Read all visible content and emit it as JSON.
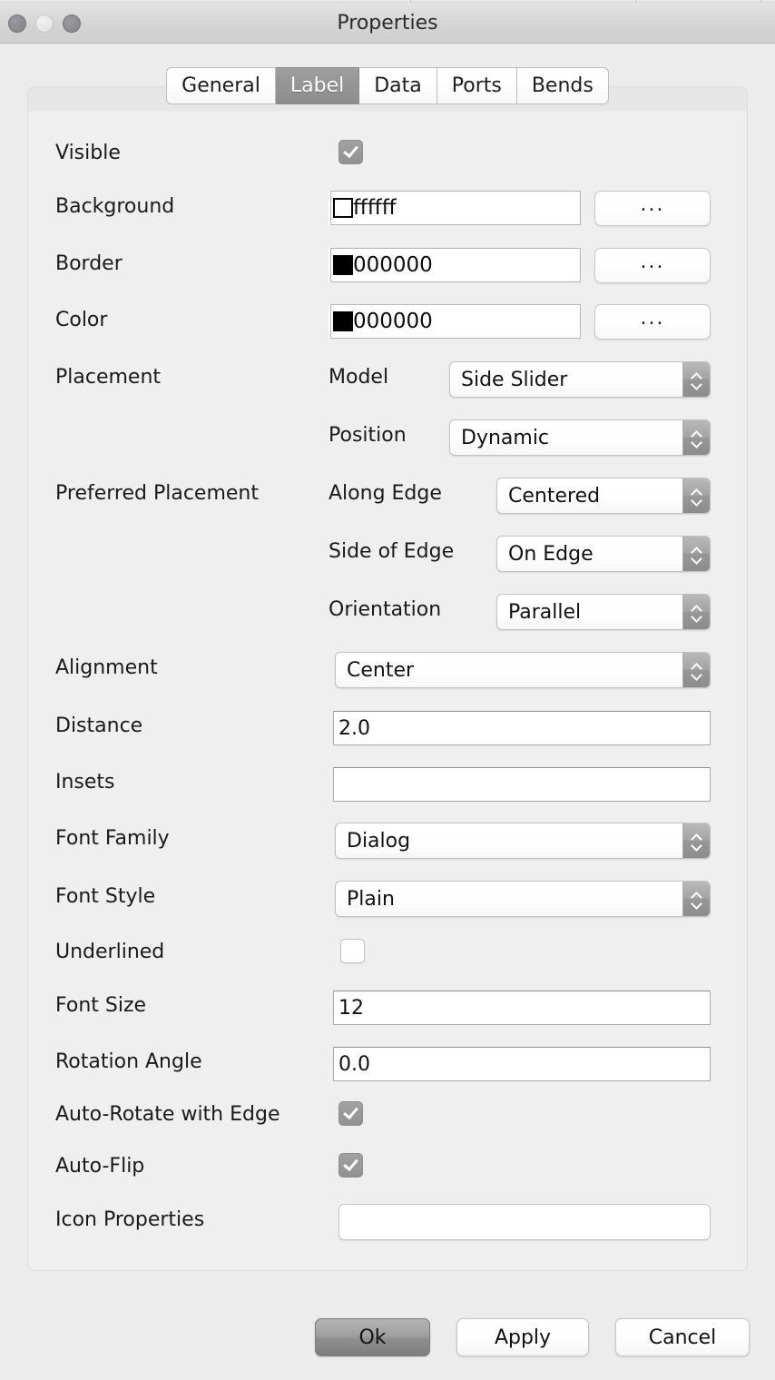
{
  "window": {
    "title": "Properties",
    "traffic_lights": [
      "close",
      "minimize",
      "zoom"
    ]
  },
  "tabs": [
    {
      "label": "General",
      "active": false
    },
    {
      "label": "Label",
      "active": true
    },
    {
      "label": "Data",
      "active": false
    },
    {
      "label": "Ports",
      "active": false
    },
    {
      "label": "Bends",
      "active": false
    }
  ],
  "form": {
    "visible": {
      "label": "Visible",
      "checked": true
    },
    "background": {
      "label": "Background",
      "value": "ffffff",
      "swatch": "#ffffff",
      "button": "..."
    },
    "border": {
      "label": "Border",
      "value": "000000",
      "swatch": "#000000",
      "button": "..."
    },
    "color": {
      "label": "Color",
      "value": "000000",
      "swatch": "#000000",
      "button": "..."
    },
    "placement": {
      "label": "Placement",
      "model": {
        "label": "Model",
        "value": "Side Slider"
      },
      "position": {
        "label": "Position",
        "value": "Dynamic"
      }
    },
    "preferred_placement": {
      "label": "Preferred Placement",
      "along_edge": {
        "label": "Along Edge",
        "value": "Centered"
      },
      "side_of_edge": {
        "label": "Side of Edge",
        "value": "On Edge"
      },
      "orientation": {
        "label": "Orientation",
        "value": "Parallel"
      }
    },
    "alignment": {
      "label": "Alignment",
      "value": "Center"
    },
    "distance": {
      "label": "Distance",
      "value": "2.0"
    },
    "insets": {
      "label": "Insets",
      "value": ""
    },
    "font_family": {
      "label": "Font Family",
      "value": "Dialog"
    },
    "font_style": {
      "label": "Font Style",
      "value": "Plain"
    },
    "underlined": {
      "label": "Underlined",
      "checked": false
    },
    "font_size": {
      "label": "Font Size",
      "value": "12"
    },
    "rotation_angle": {
      "label": "Rotation Angle",
      "value": "0.0"
    },
    "auto_rotate": {
      "label": "Auto-Rotate with Edge",
      "checked": true
    },
    "auto_flip": {
      "label": "Auto-Flip",
      "checked": true
    },
    "icon_properties": {
      "label": "Icon Properties",
      "value": ""
    }
  },
  "footer": {
    "ok": "Ok",
    "apply": "Apply",
    "cancel": "Cancel"
  },
  "colors": {
    "window_bg": "#ececec",
    "panel_bg": "#efefef",
    "accent_selected": "#949494",
    "text": "#1a1a1a"
  }
}
